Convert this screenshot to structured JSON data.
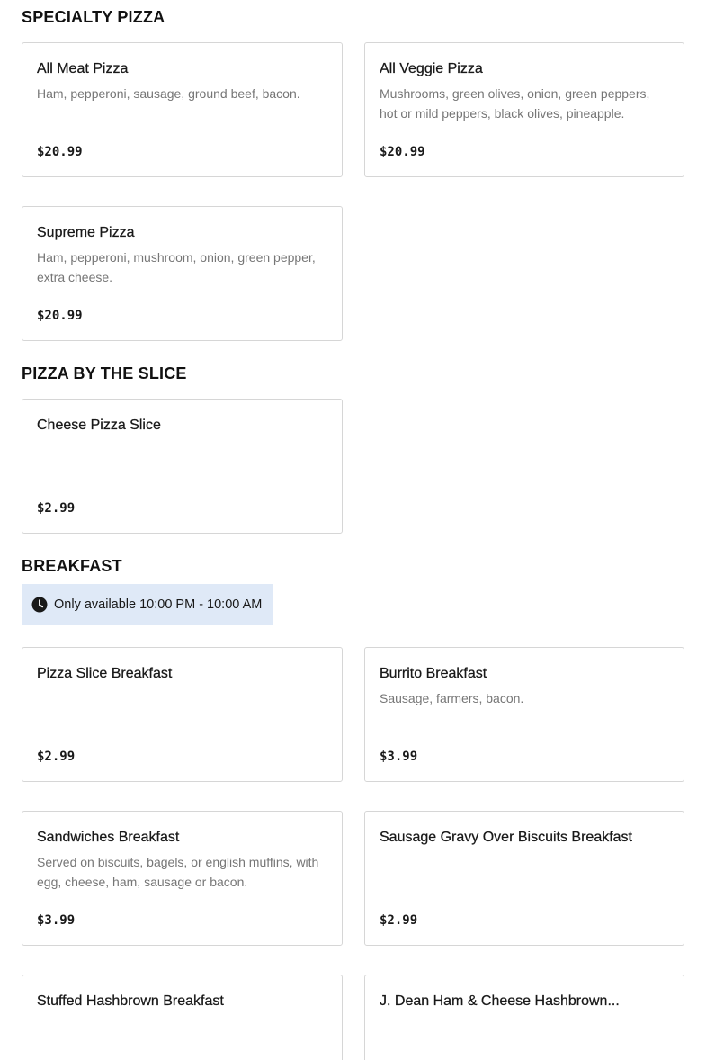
{
  "sections": {
    "specialty": {
      "title": "SPECIALTY PIZZA",
      "items": [
        {
          "name": "All Meat Pizza",
          "desc": "Ham, pepperoni, sausage, ground beef, bacon.",
          "price": "$20.99"
        },
        {
          "name": "All Veggie Pizza",
          "desc": "Mushrooms, green olives, onion, green peppers, hot or mild peppers, black olives, pineapple.",
          "price": "$20.99"
        },
        {
          "name": "Supreme Pizza",
          "desc": "Ham, pepperoni, mushroom, onion, green pepper, extra cheese.",
          "price": "$20.99"
        }
      ]
    },
    "slice": {
      "title": "PIZZA BY THE SLICE",
      "items": [
        {
          "name": "Cheese Pizza Slice",
          "desc": "",
          "price": "$2.99"
        }
      ]
    },
    "breakfast": {
      "title": "BREAKFAST",
      "availability": "Only available 10:00 PM - 10:00 AM",
      "availability_icon": "clock-icon",
      "items": [
        {
          "name": "Pizza Slice Breakfast",
          "desc": "",
          "price": "$2.99"
        },
        {
          "name": "Burrito Breakfast",
          "desc": "Sausage, farmers, bacon.",
          "price": "$3.99"
        },
        {
          "name": "Sandwiches Breakfast",
          "desc": "Served on biscuits, bagels, or english muffins, with egg, cheese, ham, sausage or bacon.",
          "price": "$3.99"
        },
        {
          "name": "Sausage Gravy Over Biscuits Breakfast",
          "desc": "",
          "price": "$2.99"
        },
        {
          "name": "Stuffed Hashbrown Breakfast",
          "desc": "",
          "price": ""
        },
        {
          "name": "J. Dean Ham & Cheese Hashbrown...",
          "desc": "",
          "price": ""
        }
      ]
    }
  },
  "colors": {
    "card_border": "#d6d6d6",
    "description_text": "#767676",
    "availability_bg": "#dfe9f7"
  }
}
